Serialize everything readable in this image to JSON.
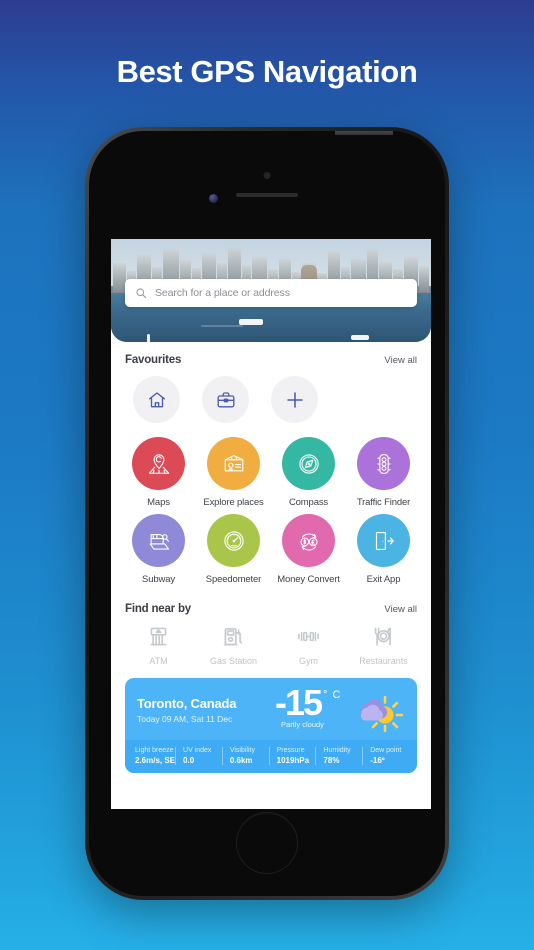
{
  "headline": "Best GPS Navigation",
  "search": {
    "placeholder": "Search for a place or address",
    "icon": "search-icon"
  },
  "favourites": {
    "title": "Favourites",
    "view_all": "View all",
    "items": [
      {
        "icon": "home-icon",
        "label": "Home"
      },
      {
        "icon": "briefcase-icon",
        "label": "Work"
      },
      {
        "icon": "plus-icon",
        "label": "Add"
      }
    ]
  },
  "tiles": [
    {
      "label": "Maps",
      "color": "#dc4a55",
      "icon": "map-pin-road-icon"
    },
    {
      "label": "Explore places",
      "color": "#f1ad40",
      "icon": "package-pin-icon"
    },
    {
      "label": "Compass",
      "color": "#34b8a3",
      "icon": "compass-icon"
    },
    {
      "label": "Traffic Finder",
      "color": "#ab72d9",
      "icon": "traffic-light-icon"
    },
    {
      "label": "Subway",
      "color": "#8f8ad8",
      "icon": "subway-train-icon"
    },
    {
      "label": "Speedometer",
      "color": "#aac64a",
      "icon": "speedometer-icon"
    },
    {
      "label": "Money Convert",
      "color": "#e16aae",
      "icon": "currency-exchange-icon"
    },
    {
      "label": "Exit App",
      "color": "#4bb4e2",
      "icon": "exit-door-icon"
    }
  ],
  "find_near_by": {
    "title": "Find near by",
    "view_all": "View all",
    "items": [
      {
        "label": "ATM",
        "icon": "atm-icon"
      },
      {
        "label": "Gas Station",
        "icon": "gas-pump-icon"
      },
      {
        "label": "Gym",
        "icon": "dumbbell-icon"
      },
      {
        "label": "Restaurants",
        "icon": "restaurant-icon"
      }
    ]
  },
  "weather": {
    "city": "Toronto, Canada",
    "date": "Today 09 AM, Sat 11 Dec",
    "temperature": "-15",
    "unit": "° C",
    "condition": "Partly cloudy",
    "icon": "sun-behind-cloud-icon",
    "stats": [
      {
        "key": "Light breeze",
        "value": "2.6m/s, SE"
      },
      {
        "key": "UV index",
        "value": "0.0"
      },
      {
        "key": "Visibility",
        "value": "0.6km"
      },
      {
        "key": "Pressure",
        "value": "1019hPa"
      },
      {
        "key": "Humidity",
        "value": "78%"
      },
      {
        "key": "Dew point",
        "value": "-16º"
      }
    ]
  },
  "colors": {
    "bg_top": "#2e3c90",
    "bg_bottom": "#26b0e8",
    "fav_icon": "#4a5bb0",
    "weather_card": "#4db4f7"
  }
}
